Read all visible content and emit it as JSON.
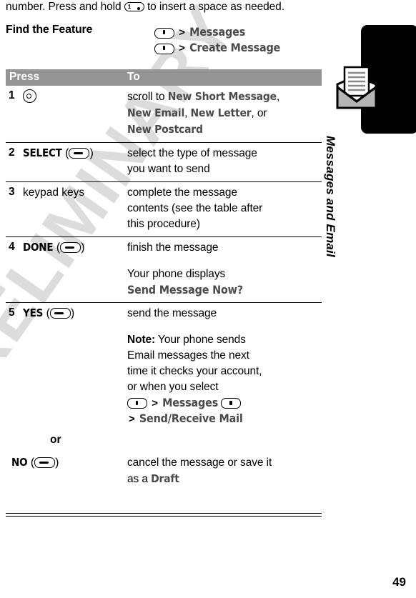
{
  "document": {
    "page_number": "49",
    "watermark": "PRELIMINARY",
    "side_tab_title": "Messages and Email",
    "side_tab_icon": "envelope-icon"
  },
  "intro": {
    "text_before_key": "number. Press and hold",
    "key_label": "1",
    "key_icon": "one-key-icon",
    "text_after_key": "to insert a space as needed."
  },
  "find_feature": {
    "label": "Find the Feature",
    "paths": [
      {
        "icon": "menu-key-icon",
        "separator": ">",
        "target": "Messages"
      },
      {
        "icon": "menu-key-icon",
        "separator": ">",
        "target": "Create Message"
      }
    ]
  },
  "procedure_table": {
    "headers": {
      "press": "Press",
      "to": "To"
    },
    "rows": [
      {
        "number": "1",
        "press_icon": "nav-key-icon",
        "press_label": "",
        "to_lines": [
          {
            "segments": [
              {
                "text": "scroll to ",
                "style": "body"
              },
              {
                "text": "New Short Message",
                "style": "display"
              },
              {
                "text": ",",
                "style": "body"
              }
            ]
          },
          {
            "segments": [
              {
                "text": "New Email",
                "style": "display"
              },
              {
                "text": ", ",
                "style": "body"
              },
              {
                "text": "New Letter",
                "style": "display"
              },
              {
                "text": ", or",
                "style": "body"
              }
            ]
          },
          {
            "segments": [
              {
                "text": "New Postcard",
                "style": "display"
              }
            ]
          }
        ]
      },
      {
        "number": "2",
        "press_label": "SELECT",
        "press_icon": "softkey-icon",
        "to_lines": [
          {
            "segments": [
              {
                "text": "select the type of message",
                "style": "body"
              }
            ]
          },
          {
            "segments": [
              {
                "text": "you want to send",
                "style": "body"
              }
            ]
          }
        ]
      },
      {
        "number": "3",
        "press_label": "keypad keys",
        "press_icon": "",
        "to_lines": [
          {
            "segments": [
              {
                "text": "complete the message",
                "style": "body"
              }
            ]
          },
          {
            "segments": [
              {
                "text": "contents (see the table after",
                "style": "body"
              }
            ]
          },
          {
            "segments": [
              {
                "text": "this procedure)",
                "style": "body"
              }
            ]
          }
        ]
      },
      {
        "number": "4",
        "press_label": "DONE",
        "press_icon": "softkey-icon",
        "to_lines": [
          {
            "segments": [
              {
                "text": "finish the message",
                "style": "body"
              }
            ]
          }
        ],
        "to_extra": [
          {
            "segments": [
              {
                "text": "Your phone displays",
                "style": "body"
              }
            ]
          },
          {
            "segments": [
              {
                "text": "Send Message Now?",
                "style": "display"
              }
            ]
          }
        ]
      },
      {
        "number": "5",
        "press_label": "YES",
        "press_icon": "softkey-icon",
        "to_lines": [
          {
            "segments": [
              {
                "text": "send the message",
                "style": "body"
              }
            ]
          }
        ],
        "note_label": "Note:",
        "note_lines": [
          {
            "segments": [
              {
                "text": " Your phone sends",
                "style": "body"
              }
            ]
          },
          {
            "segments": [
              {
                "text": "Email messages the next",
                "style": "body"
              }
            ]
          },
          {
            "segments": [
              {
                "text": "time it checks your account,",
                "style": "body"
              }
            ]
          },
          {
            "segments": [
              {
                "text": "or when you select",
                "style": "body"
              }
            ]
          }
        ],
        "note_path_line_1": {
          "icon": "menu-key-icon",
          "separator": ">",
          "target": "Messages",
          "trailing_icon": "menu-key-icon"
        },
        "note_path_line_2": {
          "separator": ">",
          "target": "Send/Receive Mail"
        },
        "or_word": "or"
      },
      {
        "number": "",
        "press_label": "NO",
        "press_icon": "softkey-icon",
        "to_lines": [
          {
            "segments": [
              {
                "text": "cancel the message or save it",
                "style": "body"
              }
            ]
          },
          {
            "segments": [
              {
                "text": "as a ",
                "style": "body"
              },
              {
                "text": "Draft",
                "style": "display"
              }
            ]
          }
        ]
      }
    ]
  },
  "colors": {
    "header_band": "#949494",
    "display_text": "#4a4a4a",
    "watermark": "#dcdcdc",
    "side_tab": "#000000"
  }
}
